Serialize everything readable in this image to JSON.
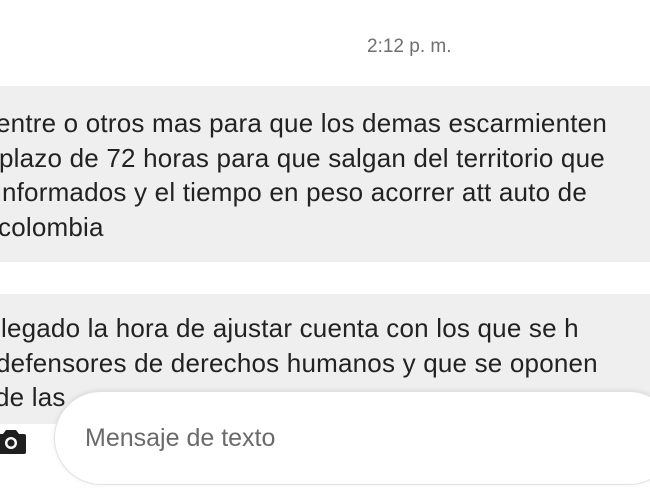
{
  "conversation": {
    "timestamp": "2:12 p. m.",
    "messages": [
      {
        "lines": [
          "entre o otros mas para que los demas escarmienten",
          "plazo de 72 horas para que salgan del territorio que",
          "informados y el tiempo en peso acorrer att auto de",
          "colombia"
        ]
      },
      {
        "lines": [
          "llegado la hora de ajustar cuenta con los que se h",
          "defensores de derechos humanos y que se oponen",
          "de las"
        ]
      }
    ]
  },
  "compose": {
    "placeholder": "Mensaje de texto",
    "value": "",
    "camera_icon": "camera-icon"
  }
}
